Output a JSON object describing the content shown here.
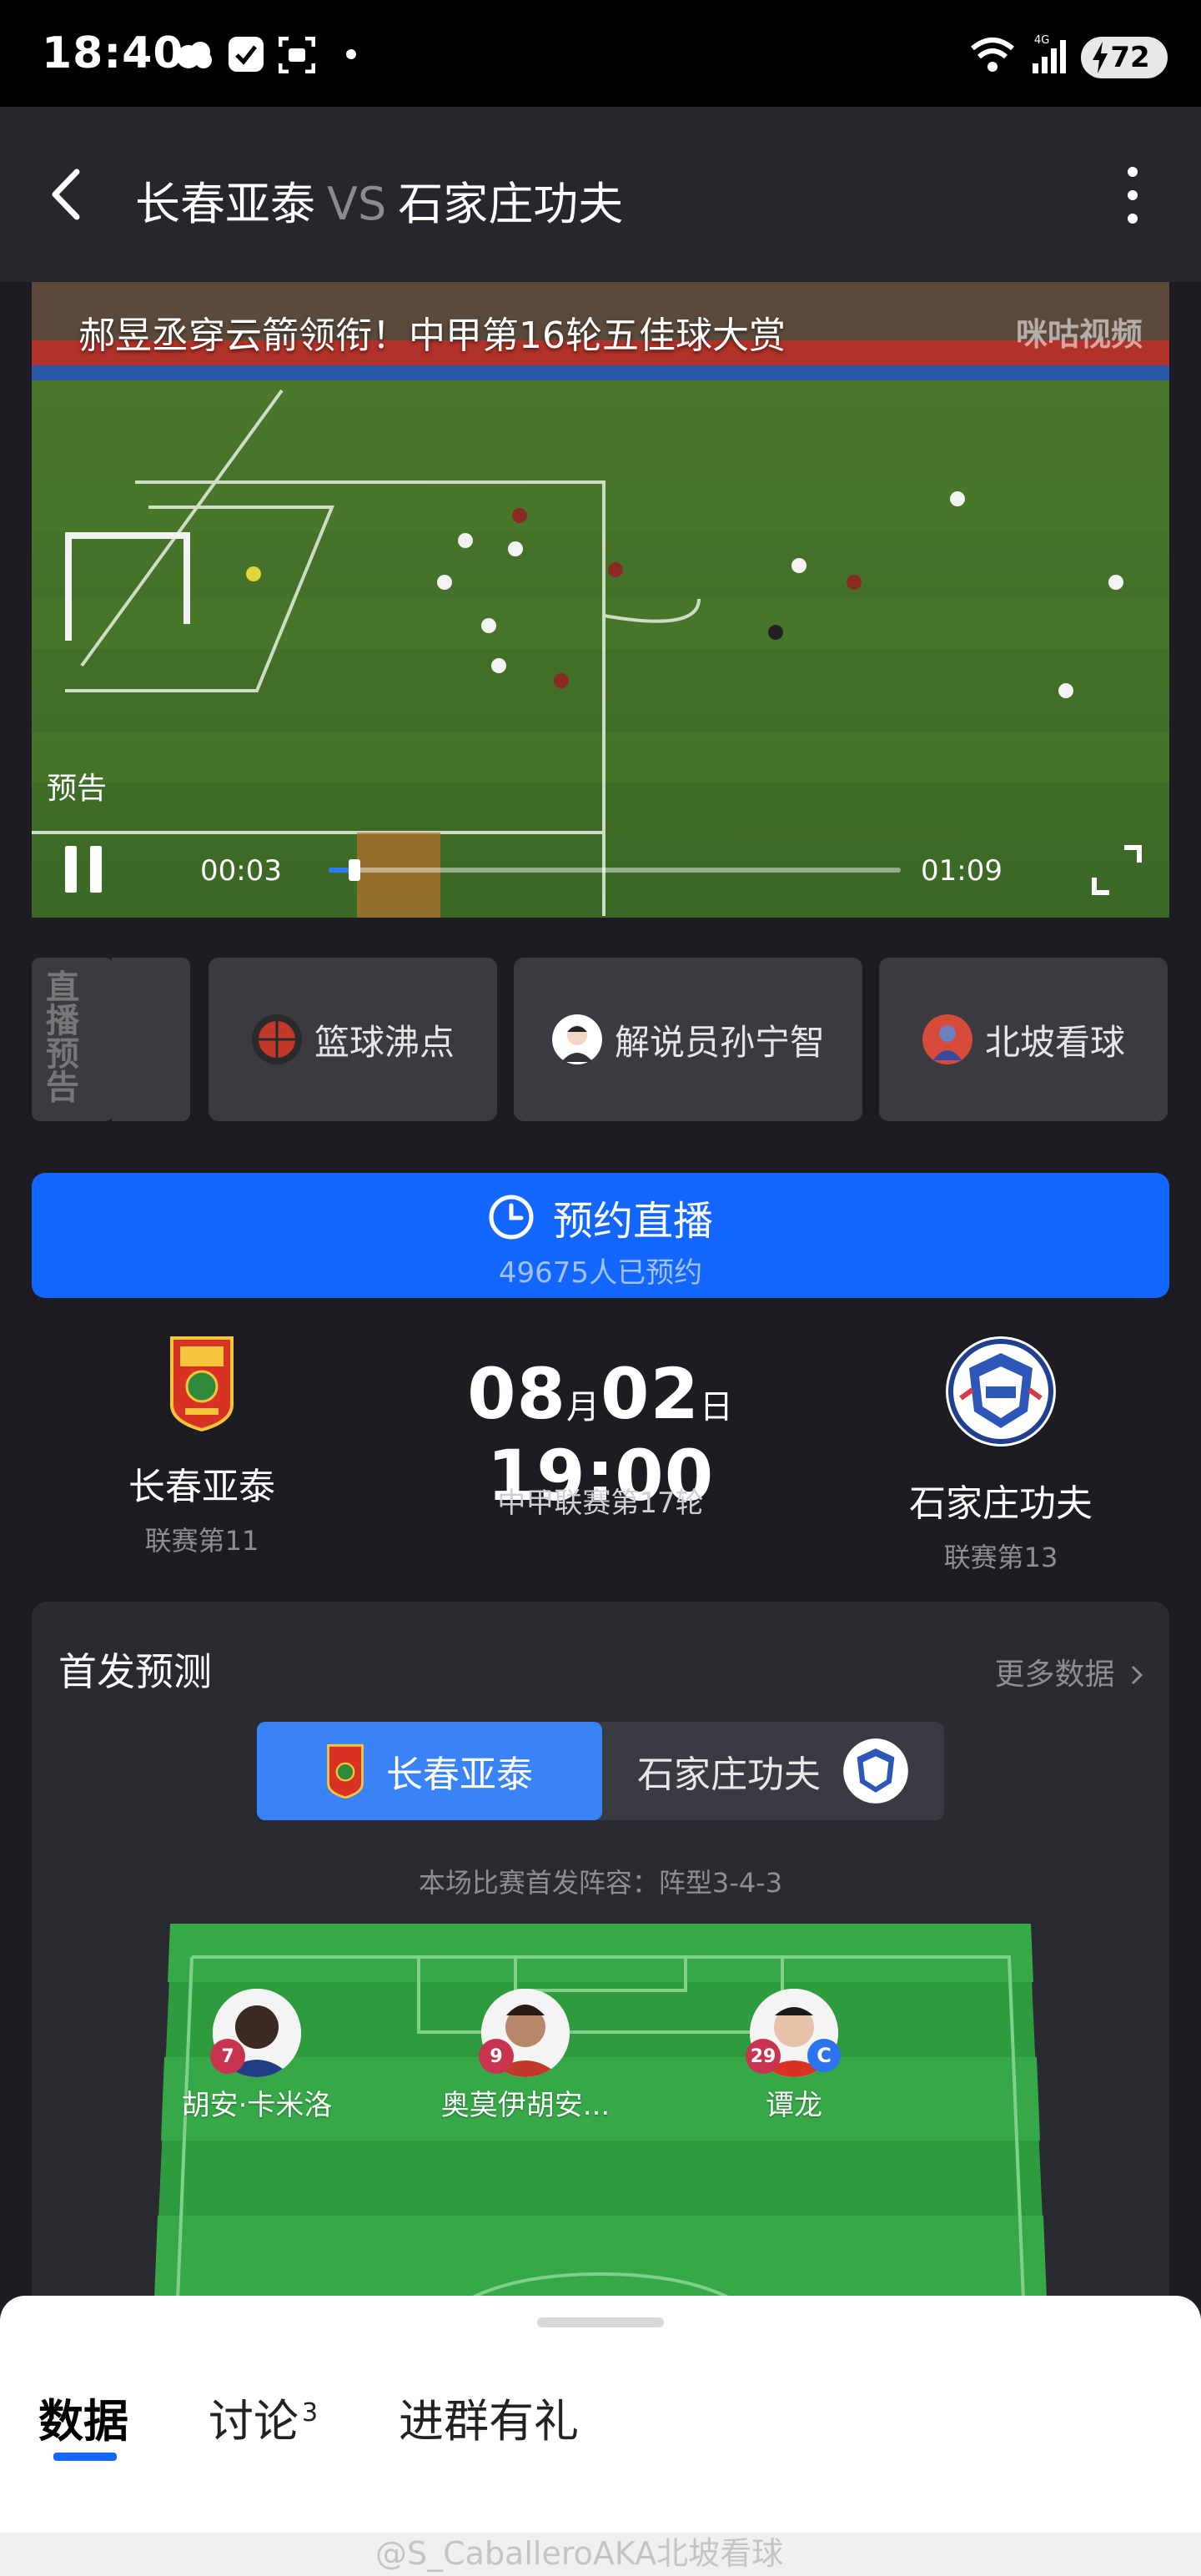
{
  "status_bar": {
    "time": "18:40",
    "battery": "72",
    "network": "4G"
  },
  "header": {
    "home_team": "长春亚泰",
    "vs": "VS",
    "away_team": "石家庄功夫"
  },
  "video": {
    "title": "郝昱丞穿云箭领衔！中甲第16轮五佳球大赏",
    "logo_text": "咪咕视频",
    "preview_label": "预告",
    "current_time": "00:03",
    "total_time": "01:09",
    "progress": 0.045
  },
  "channels": {
    "live_tag": "直播预告",
    "items": [
      {
        "label": "篮球沸点",
        "avatar_color": "#c0392b"
      },
      {
        "label": "解说员孙宁智",
        "avatar_color": "#f2d5c6"
      },
      {
        "label": "北坡看球",
        "avatar_color": "#d84a3a"
      }
    ]
  },
  "reserve": {
    "label": "预约直播",
    "count_text": "49675人已预约"
  },
  "match": {
    "date_month": "08",
    "month_unit": "月",
    "date_day": "02",
    "day_unit": "日",
    "time": "19:00",
    "league_round": "中甲联赛第17轮",
    "home": {
      "name": "长春亚泰",
      "rank": "联赛第11"
    },
    "away": {
      "name": "石家庄功夫",
      "rank": "联赛第13"
    }
  },
  "lineup": {
    "title": "首发预测",
    "more_data": "更多数据",
    "tab_home": "长春亚泰",
    "tab_away": "石家庄功夫",
    "formation": "本场比赛首发阵容：阵型3-4-3",
    "players": [
      {
        "number": "7",
        "name": "胡安·卡米洛",
        "captain": ""
      },
      {
        "number": "9",
        "name": "奥莫伊胡安...",
        "captain": ""
      },
      {
        "number": "29",
        "name": "谭龙",
        "captain": "C"
      }
    ]
  },
  "bottom_tabs": {
    "data": "数据",
    "discussion": "讨论",
    "discussion_count": "3",
    "group": "进群有礼"
  },
  "watermark": "@S_CaballeroAKA北坡看球"
}
